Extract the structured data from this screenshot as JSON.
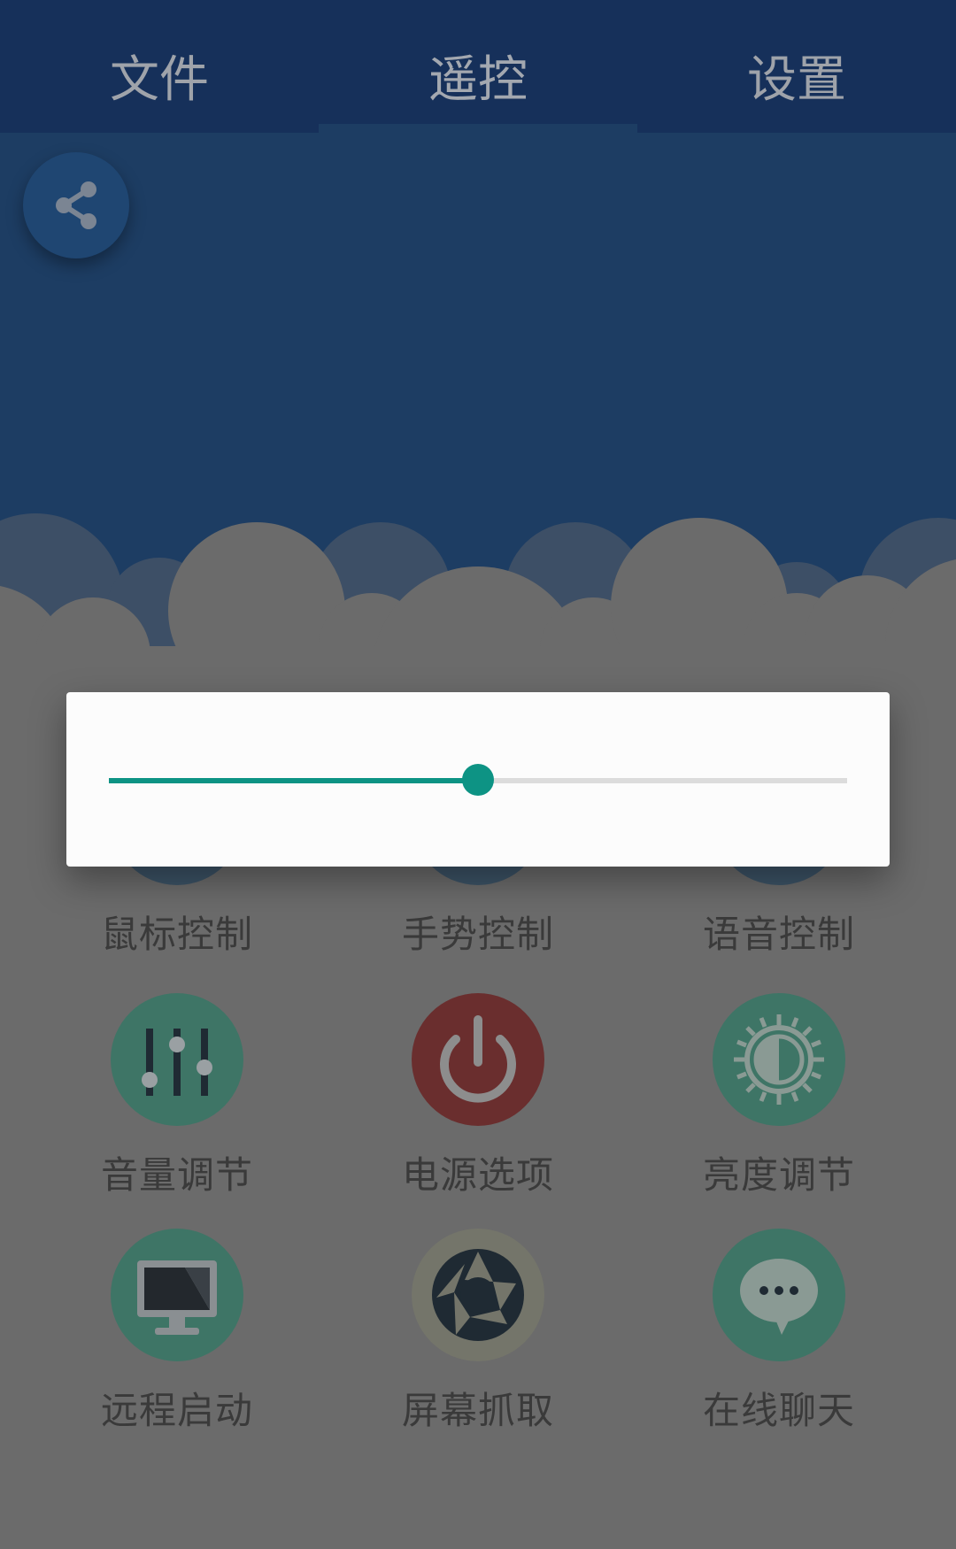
{
  "tabs": [
    {
      "label": "文件",
      "active": false
    },
    {
      "label": "遥控",
      "active": true
    },
    {
      "label": "设置",
      "active": false
    }
  ],
  "share_button": {
    "icon": "share-icon"
  },
  "grid": {
    "row1": [
      {
        "label": "鼠标控制",
        "icon": "mouse-icon"
      },
      {
        "label": "手势控制",
        "icon": "gesture-icon"
      },
      {
        "label": "语音控制",
        "icon": "voice-icon"
      }
    ],
    "row2": [
      {
        "label": "音量调节",
        "icon": "equalizer-icon"
      },
      {
        "label": "电源选项",
        "icon": "power-icon"
      },
      {
        "label": "亮度调节",
        "icon": "brightness-icon"
      }
    ],
    "row3": [
      {
        "label": "远程启动",
        "icon": "monitor-icon"
      },
      {
        "label": "屏幕抓取",
        "icon": "camera-shutter-icon"
      },
      {
        "label": "在线聊天",
        "icon": "chat-bubble-icon"
      }
    ]
  },
  "dialog": {
    "slider": {
      "value": 0.5
    }
  },
  "colors": {
    "header": "#16305a",
    "hero": "#1d3d63",
    "accent": "#0d9384",
    "green_circle": "#3e7566",
    "red_circle": "#6a2e2e",
    "gray_circle": "#74756a"
  }
}
